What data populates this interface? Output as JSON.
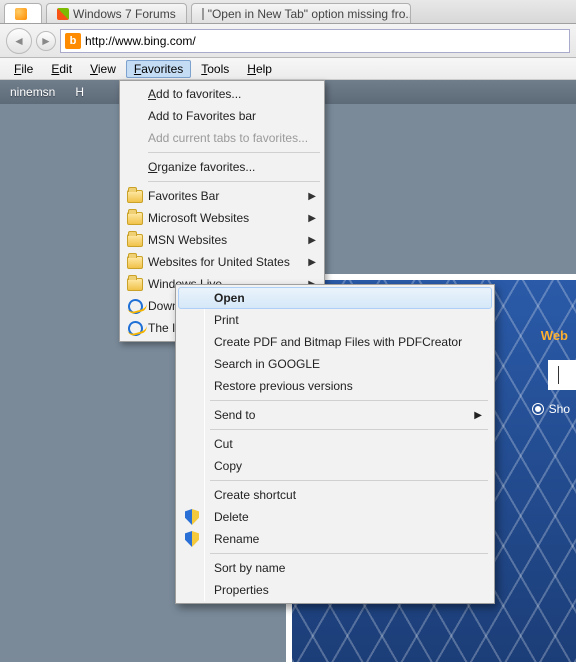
{
  "tabs": [
    {
      "label": ""
    },
    {
      "label": "Windows 7 Forums"
    },
    {
      "label": "\"Open in New Tab\" option missing fro..."
    }
  ],
  "address": {
    "url": "http://www.bing.com/",
    "bing_glyph": "b"
  },
  "nav_arrows": {
    "back": "◄",
    "forward": "►"
  },
  "menubar": {
    "file": "File",
    "file_u": "F",
    "edit": "Edit",
    "edit_u": "E",
    "view": "View",
    "view_u": "V",
    "favorites": "Favorites",
    "favorites_u": "F",
    "tools": "Tools",
    "tools_u": "T",
    "help": "Help",
    "help_u": "H"
  },
  "page_toolbar": {
    "item1": "ninemsn",
    "item2": "Hotmail"
  },
  "favorites_menu": {
    "add_to_favorites": "Add to favorites...",
    "add_to_favorites_bar": "Add to Favorites bar",
    "add_current_tabs": "Add current tabs to favorites...",
    "organize": "Organize favorites...",
    "folders": [
      "Favorites Bar",
      "Microsoft Websites",
      "MSN Websites",
      "Websites for United States",
      "Windows Live"
    ],
    "links": [
      "Download IObit Freeware",
      "The I"
    ]
  },
  "context_menu": {
    "open": "Open",
    "print": "Print",
    "create_pdf": "Create PDF and Bitmap Files with PDFCreator",
    "search_google": "Search in GOOGLE",
    "restore_prev": "Restore previous versions",
    "send_to": "Send to",
    "cut": "Cut",
    "copy": "Copy",
    "create_shortcut": "Create shortcut",
    "delete": "Delete",
    "rename": "Rename",
    "sort_by_name": "Sort by name",
    "properties": "Properties"
  },
  "content": {
    "web_label": "Web",
    "show_label": "Sho"
  }
}
